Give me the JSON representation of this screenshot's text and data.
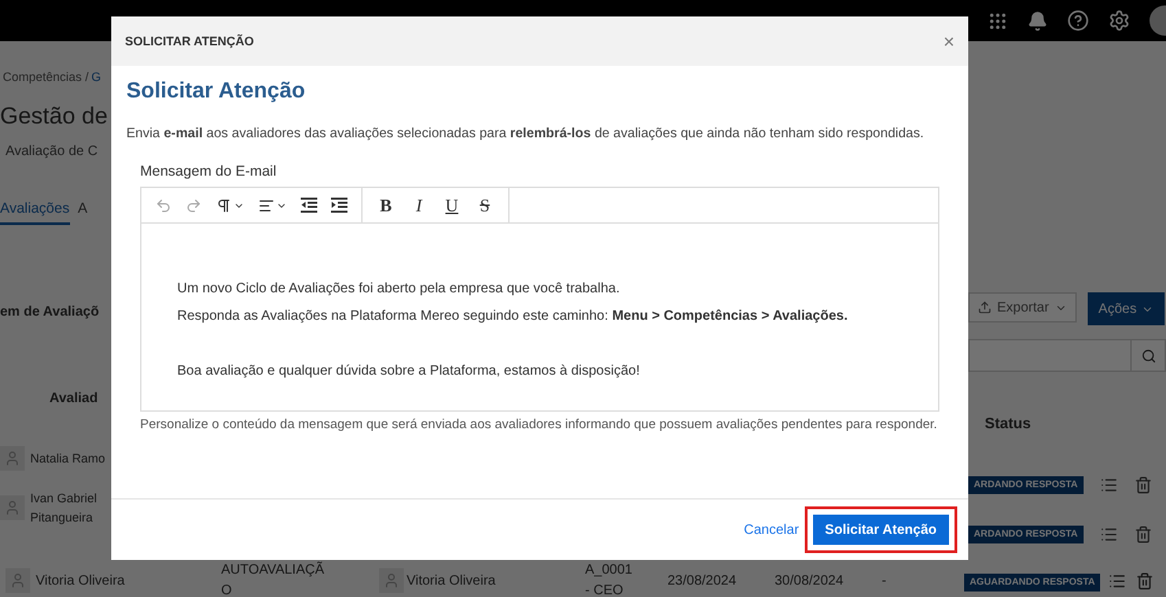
{
  "background": {
    "breadcrumb": "Competências /",
    "breadcrumb_link": "G",
    "page_title": "Gestão de",
    "subtitle": "Avaliação de C",
    "tabs": [
      {
        "label": "Avaliações",
        "selected": true
      },
      {
        "label": "A",
        "selected": false
      }
    ],
    "section_title": "em de Avaliaçõ",
    "export_button": "Exportar",
    "actions_button": "Ações",
    "columns": [
      "Avaliad",
      "Status"
    ],
    "rows": [
      {
        "name": "Natalia Ramo",
        "status": "ARDANDO RESPOSTA"
      },
      {
        "name": "Ivan Gabriel",
        "name_line_2": "Pitangueira",
        "status": "ARDANDO RESPOSTA"
      }
    ],
    "last_row": {
      "name": "Vitoria Oliveira",
      "type": "AUTOAVALIAÇÃ",
      "type_line_2": "O",
      "evaluator": "Vitoria Oliveira",
      "role": "A_0001",
      "role_line_2": "- CEO",
      "start": "23/08/2024",
      "end": "30/08/2024",
      "result": "-",
      "status": "AGUARDANDO RESPOSTA"
    }
  },
  "modal": {
    "header": "SOLICITAR ATENÇÃO",
    "close": "×",
    "title": "Solicitar Atenção",
    "description": "Envia **e-mail** aos avaliadores das avaliações selecionadas para **relembrá-los** de avaliações que ainda não tenham sido respondidas.",
    "editor_label": "Mensagem do E-mail",
    "tools": [
      {
        "kind": "undo",
        "disabled": true
      },
      {
        "kind": "redo",
        "disabled": true
      },
      {
        "kind": "paragraph",
        "disabled": false
      },
      {
        "kind": "align",
        "disabled": false
      },
      {
        "kind": "outdent",
        "disabled": false
      },
      {
        "kind": "indent",
        "disabled": false
      }
    ],
    "format_buttons": [
      {
        "label": "B",
        "kind": "bold"
      },
      {
        "label": "I",
        "kind": "italic"
      },
      {
        "label": "U",
        "kind": "underline"
      },
      {
        "label": "S",
        "kind": "strike"
      }
    ],
    "paragraph_groups": [
      [
        "Um novo Ciclo de Avaliações foi aberto pela empresa que você trabalha.",
        "Responda as Avaliações na Plataforma Mereo seguindo este caminho: **Menu > Competências > Avaliações.**"
      ],
      [
        "Boa avaliação e qualquer dúvida sobre a Plataforma, estamos à disposição!"
      ]
    ],
    "help_text": "Personalize o conteúdo da mensagem que será enviada aos avaliadores informando que possuem avaliações pendentes para responder.",
    "cancel": "Cancelar",
    "submit": {
      "label": "Solicitar Atenção",
      "highlighted": true
    }
  }
}
